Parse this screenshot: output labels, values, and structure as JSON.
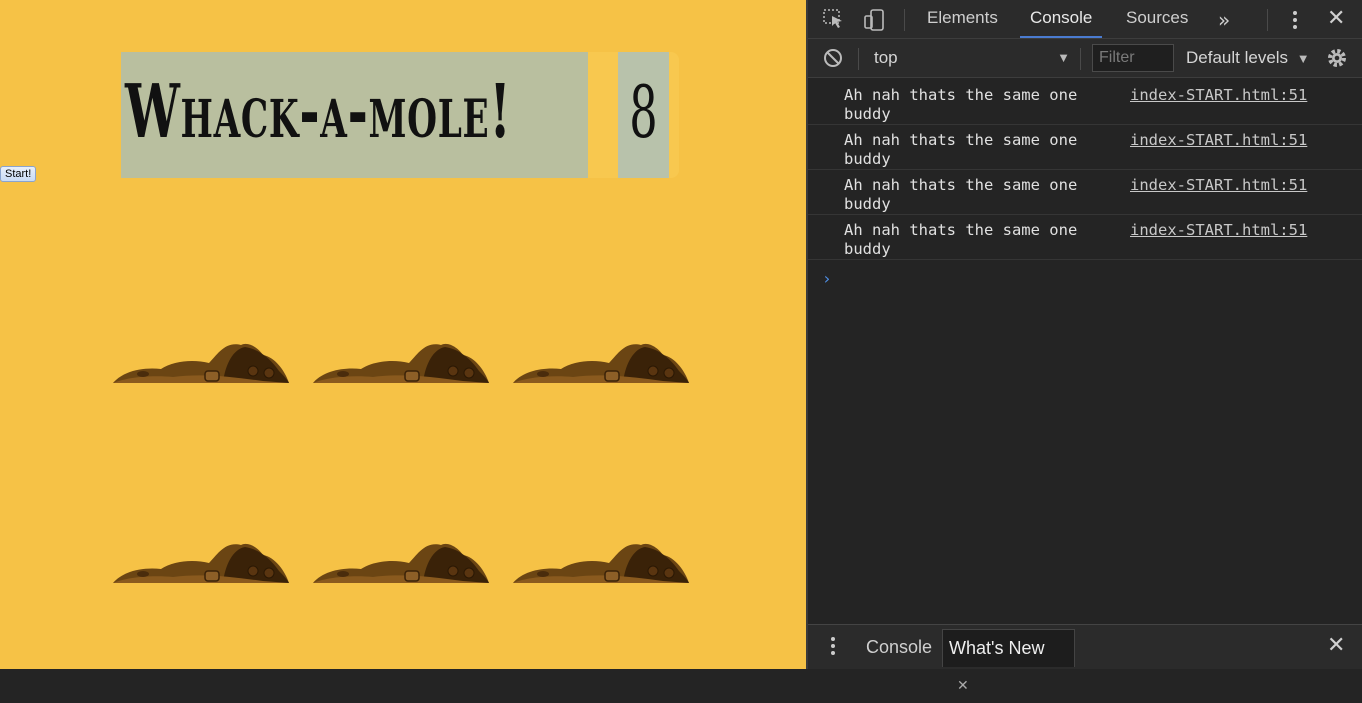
{
  "game": {
    "title": "Whack-a-mole!",
    "score": "8",
    "start_button": "Start!",
    "holes": [
      "hole-1",
      "hole-2",
      "hole-3",
      "hole-4",
      "hole-5",
      "hole-6"
    ],
    "colors": {
      "background": "#f6c246",
      "title_bg": "#b9bf9f",
      "dirt": "#6b4513"
    }
  },
  "devtools": {
    "tabs": [
      "Elements",
      "Console",
      "Sources"
    ],
    "active_tab": "Console",
    "more_tabs_icon": "chevron-double-right-icon",
    "context": "top",
    "filter_placeholder": "Filter",
    "levels": "Default levels",
    "logs": [
      {
        "message": "Ah nah thats the same one buddy",
        "source": "index-START.html:51"
      },
      {
        "message": "Ah nah thats the same one buddy",
        "source": "index-START.html:51"
      },
      {
        "message": "Ah nah thats the same one buddy",
        "source": "index-START.html:51"
      },
      {
        "message": "Ah nah thats the same one buddy",
        "source": "index-START.html:51"
      }
    ],
    "prompt_symbol": "›",
    "drawer_tabs": [
      "Console",
      "What's New"
    ],
    "drawer_active": "What's New"
  }
}
